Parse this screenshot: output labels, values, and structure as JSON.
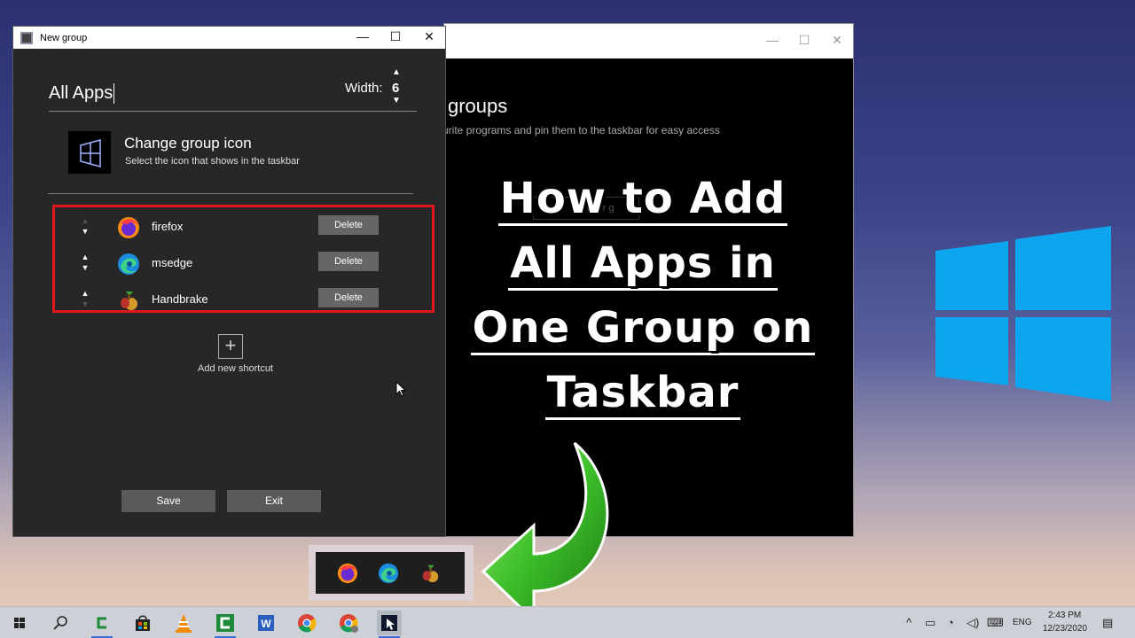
{
  "dialog": {
    "title": "New group",
    "controls": {
      "minimize": "—",
      "maximize": "☐",
      "close": "✕"
    },
    "group_name": "All Apps",
    "width_label": "Width:",
    "width_value": "6",
    "change_icon_title": "Change group icon",
    "change_icon_sub": "Select the icon that shows in the taskbar",
    "shortcuts": [
      {
        "name": "firefox",
        "delete_label": "Delete",
        "icon": "firefox-icon"
      },
      {
        "name": "msedge",
        "delete_label": "Delete",
        "icon": "edge-icon"
      },
      {
        "name": "Handbrake",
        "delete_label": "Delete",
        "icon": "handbrake-icon"
      }
    ],
    "add_label": "Add new shortcut",
    "save_label": "Save",
    "exit_label": "Exit"
  },
  "background_window": {
    "heading": "groups",
    "subtitle": "urite programs and pin them to the taskbar for easy access",
    "ghost_text": "kbar g"
  },
  "headline": {
    "lines": [
      "How to Add",
      "All Apps in",
      "One Group on",
      "Taskbar"
    ]
  },
  "taskbar": {
    "time": "2:43 PM",
    "date": "12/23/2020",
    "language": "ENG",
    "pinned": [
      "start-icon",
      "search-icon",
      "camtasia-icon",
      "store-icon",
      "vlc-icon",
      "camtasia-2-icon",
      "word-icon",
      "chrome-icon",
      "chrome-2-icon",
      "taskbar-groups-icon"
    ]
  },
  "colors": {
    "highlight_border": "#e0171d",
    "dialog_bg": "#272727",
    "button_bg": "#5a5a5a",
    "windows_blue": "#0ea5ef",
    "arrow_green": "#3dbf2a"
  }
}
